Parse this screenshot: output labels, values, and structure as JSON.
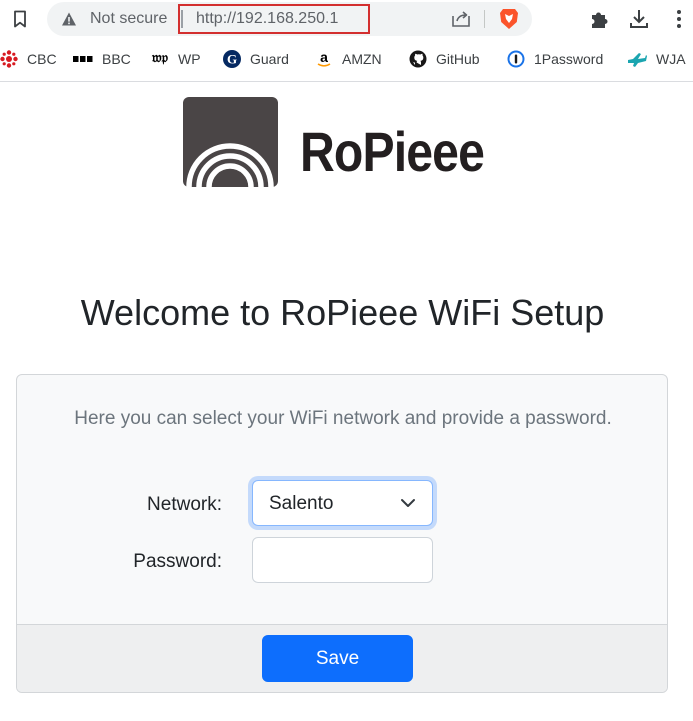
{
  "browser": {
    "security_label": "Not secure",
    "url": "http://192.168.250.1",
    "icons": {
      "bookmark_toggle": "bookmark-icon",
      "warning": "warning-triangle-icon",
      "share": "share-icon",
      "brave": "brave-shields-icon",
      "extensions": "puzzle-piece-icon",
      "download": "download-icon",
      "menu": "kebab-menu-icon"
    },
    "highlight_color": "#d32f2f",
    "bookmarks": [
      {
        "label": "CBC",
        "icon": "cbc-icon"
      },
      {
        "label": "BBC",
        "icon": "bbc-icon"
      },
      {
        "label": "WP",
        "icon": "wp-icon"
      },
      {
        "label": "Guard",
        "icon": "guardian-icon"
      },
      {
        "label": "AMZN",
        "icon": "amazon-icon"
      },
      {
        "label": "GitHub",
        "icon": "github-icon"
      },
      {
        "label": "1Password",
        "icon": "1password-icon"
      },
      {
        "label": "WJA",
        "icon": "wja-icon"
      }
    ]
  },
  "page": {
    "brand_name": "RoPieee",
    "title": "Welcome to RoPieee WiFi Setup",
    "intro": "Here you can select your WiFi network and provide a password.",
    "network_label": "Network:",
    "network_selected": "Salento",
    "password_label": "Password:",
    "password_value": "",
    "save_label": "Save",
    "accent_color": "#0d6efd"
  }
}
